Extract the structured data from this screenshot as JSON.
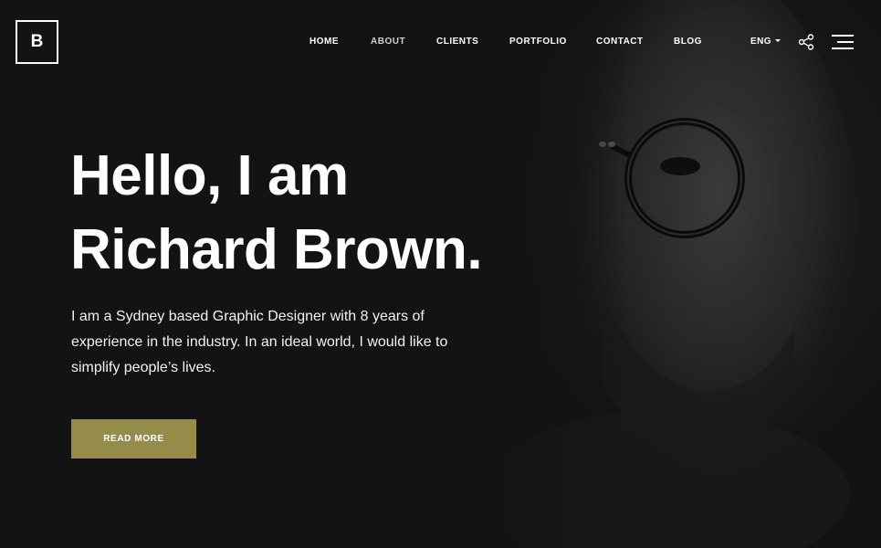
{
  "brand": {
    "logo_letter": "B"
  },
  "nav": {
    "items": [
      {
        "label": "HOME"
      },
      {
        "label": "ABOUT",
        "active": true
      },
      {
        "label": "CLIENTS"
      },
      {
        "label": "PORTFOLIO"
      },
      {
        "label": "CONTACT"
      },
      {
        "label": "BLOG"
      }
    ],
    "language": "ENG",
    "icons": [
      "caret-down-icon",
      "share-icon",
      "menu-icon"
    ]
  },
  "hero": {
    "title_line1": "Hello, I am",
    "title_line2": "Richard Brown.",
    "description": "I am a Sydney based Graphic Designer with 8 years of experience in the industry. In an ideal world, I would like to simplify people’s lives.",
    "cta_label": "READ MORE"
  },
  "colors": {
    "background": "#131313",
    "accent": "#948c48",
    "text": "#ffffff"
  }
}
